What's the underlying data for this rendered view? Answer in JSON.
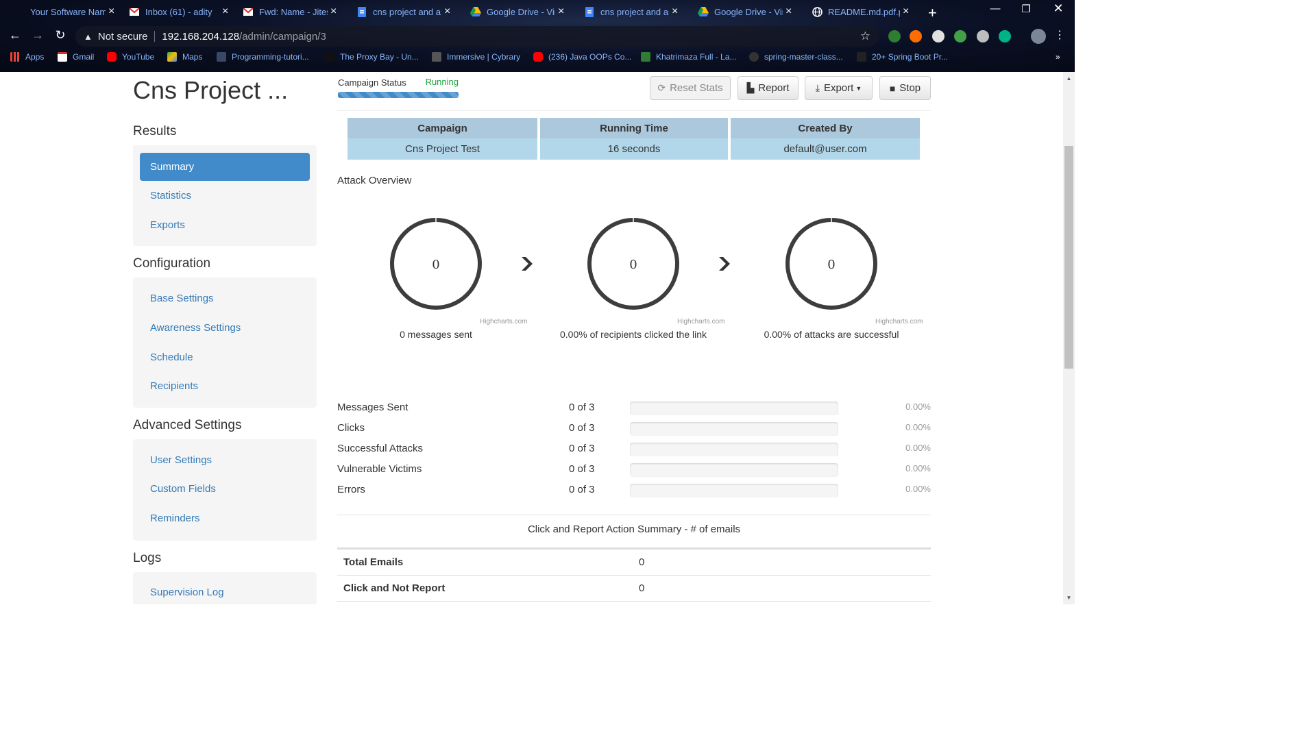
{
  "browser": {
    "tabs": [
      {
        "label": "Your Software Nam",
        "icon": "page-icon"
      },
      {
        "label": "Inbox (61) - adity",
        "icon": "gmail-icon"
      },
      {
        "label": "Fwd: Name - Jitesh",
        "icon": "gmail-icon"
      },
      {
        "label": "cns project and as",
        "icon": "docs-icon"
      },
      {
        "label": "Google Drive - Vir",
        "icon": "drive-icon"
      },
      {
        "label": "cns project and as",
        "icon": "docs-icon"
      },
      {
        "label": "Google Drive - Vir",
        "icon": "drive-icon"
      },
      {
        "label": "README.md.pdf.p",
        "icon": "globe-icon"
      }
    ],
    "address": {
      "security": "Not secure",
      "host": "192.168.204.128",
      "path": "/admin/campaign/3"
    },
    "bookmarks": [
      "Apps",
      "Gmail",
      "YouTube",
      "Maps",
      "Programming-tutori...",
      "The Proxy Bay - Un...",
      "Immersive | Cybrary",
      "(236) Java OOPs Co...",
      "Khatrimaza Full - La...",
      "spring-master-class...",
      "20+ Spring Boot Pr..."
    ]
  },
  "header": {
    "title": "Cns Project ...",
    "status_label": "Campaign Status",
    "status_value": "Running",
    "buttons": {
      "reset": "Reset Stats",
      "report": "Report",
      "export": "Export",
      "stop": "Stop"
    }
  },
  "sidebar": {
    "results_heading": "Results",
    "results_items": [
      "Summary",
      "Statistics",
      "Exports"
    ],
    "config_heading": "Configuration",
    "config_items": [
      "Base Settings",
      "Awareness Settings",
      "Schedule",
      "Recipients"
    ],
    "advanced_heading": "Advanced Settings",
    "advanced_items": [
      "User Settings",
      "Custom Fields",
      "Reminders"
    ],
    "logs_heading": "Logs",
    "logs_items": [
      "Supervision Log"
    ]
  },
  "info": {
    "campaign_header": "Campaign",
    "campaign_value": "Cns Project Test",
    "time_header": "Running Time",
    "time_value": "16 seconds",
    "creator_header": "Created By",
    "creator_value": "default@user.com"
  },
  "overview": {
    "title": "Attack Overview",
    "credit": "Highcharts.com",
    "donuts": [
      {
        "value": "0",
        "label": "0 messages sent"
      },
      {
        "value": "0",
        "label": "0.00% of recipients clicked the link"
      },
      {
        "value": "0",
        "label": "0.00% of attacks are successful"
      }
    ]
  },
  "stats": [
    {
      "label": "Messages Sent",
      "count": "0 of 3",
      "percent": "0.00%",
      "fill": 0
    },
    {
      "label": "Clicks",
      "count": "0 of 3",
      "percent": "0.00%",
      "fill": 0
    },
    {
      "label": "Successful Attacks",
      "count": "0 of 3",
      "percent": "0.00%",
      "fill": 0
    },
    {
      "label": "Vulnerable Victims",
      "count": "0 of 3",
      "percent": "0.00%",
      "fill": 0
    },
    {
      "label": "Errors",
      "count": "0 of 3",
      "percent": "0.00%",
      "fill": 0
    }
  ],
  "summary": {
    "title": "Click and Report Action Summary - # of emails",
    "rows": [
      {
        "label": "Total Emails",
        "value": "0"
      },
      {
        "label": "Click and Not Report",
        "value": "0"
      }
    ]
  },
  "colors": {
    "accent": "#428bca",
    "running": "#18a53f",
    "donut": "#3d3d3d"
  }
}
